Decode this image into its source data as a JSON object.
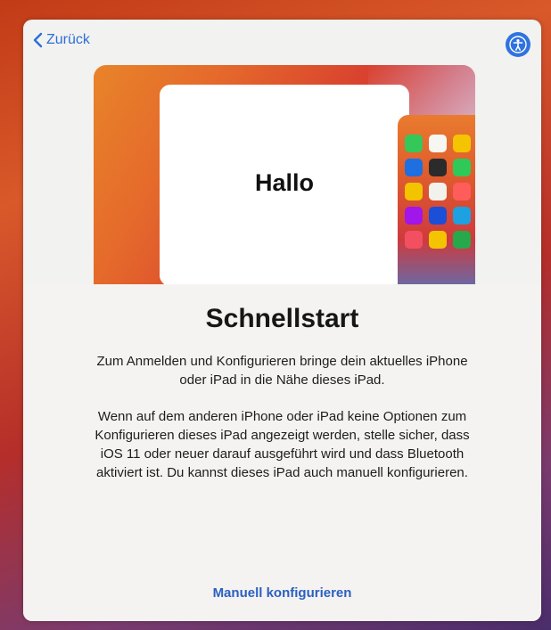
{
  "nav": {
    "back_label": "Zurück"
  },
  "illustration": {
    "card_text": "Hallo",
    "app_colors": [
      "#34c759",
      "#f6f6f2",
      "#f4c400",
      "#e2e2de",
      "#1e6fe0",
      "#2b2b2b",
      "#2fc95a",
      "#2a6de8",
      "#f3c300",
      "#f3f1ec",
      "#ff5c5c",
      "#3b3fd8",
      "#a116e8",
      "#1b4fd8",
      "#1ea1e0",
      "#ff8a00",
      "#f25060",
      "#f4c400",
      "#27a84a",
      "#ecebe7"
    ]
  },
  "content": {
    "title": "Schnellstart",
    "paragraph1": "Zum Anmelden und Konfigurieren bringe dein aktuelles iPhone oder iPad in die Nähe dieses iPad.",
    "paragraph2": "Wenn auf dem anderen iPhone oder iPad keine Optionen zum Konfigurieren dieses iPad angezeigt werden, stelle sicher, dass iOS 11 oder neuer darauf ausgeführt wird und dass Bluetooth aktiviert ist. Du kannst dieses iPad auch manuell konfigurieren.",
    "manual_link": "Manuell konfigurieren"
  },
  "colors": {
    "accent": "#2c6fd6",
    "sheet": "#f2f2f0"
  }
}
